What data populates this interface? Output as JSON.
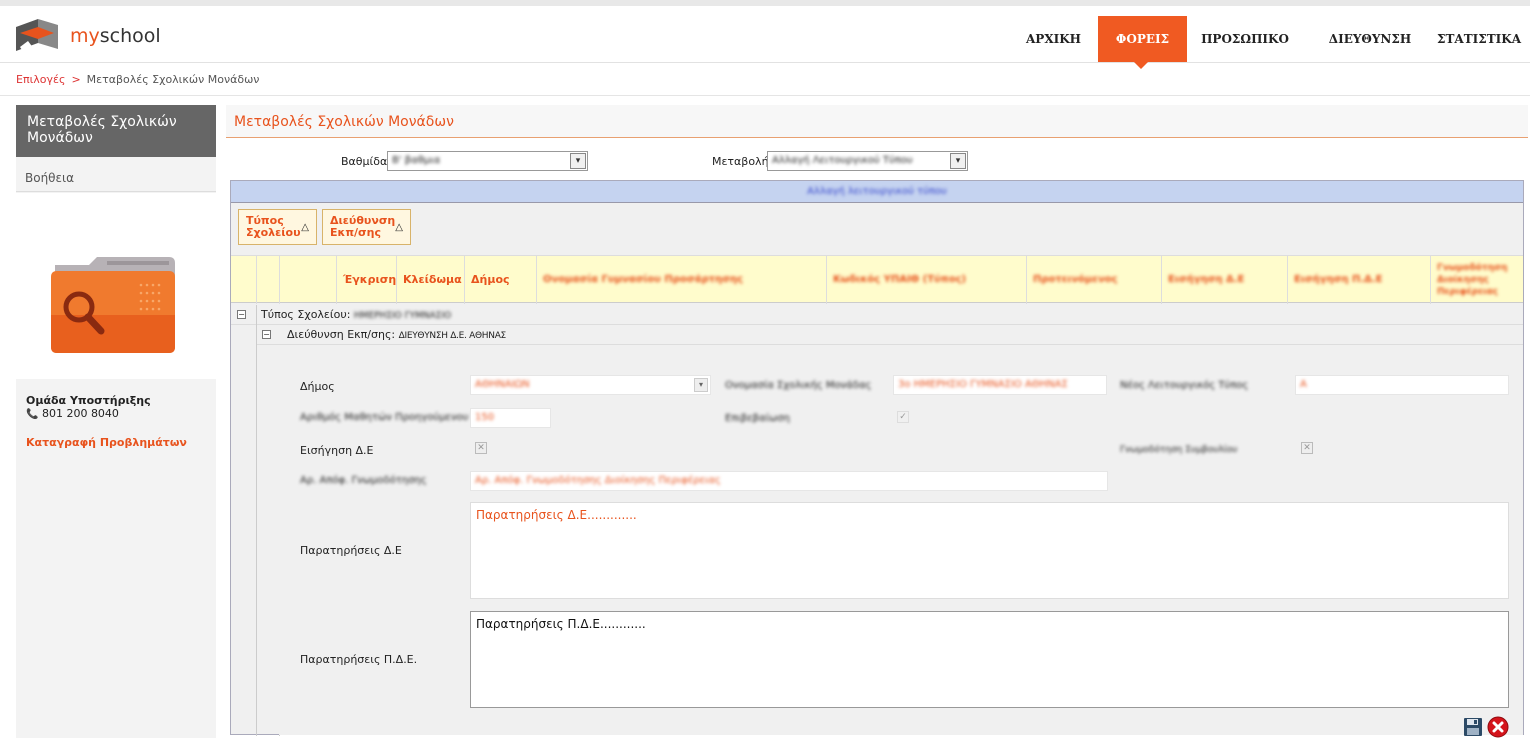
{
  "app": {
    "logo_prefix": "my",
    "logo_suffix": "school"
  },
  "nav": {
    "items": [
      {
        "label": "ΑΡΧΙΚΗ"
      },
      {
        "label": "ΦΟΡΕΙΣ"
      },
      {
        "label": "ΠΡΟΣΩΠΙΚΟ"
      },
      {
        "label": "ΔΙΕΥΘΥΝΣΗ"
      },
      {
        "label": "ΣΤΑΤΙΣΤΙΚΑ"
      }
    ],
    "active": "ΦΟΡΕΙΣ"
  },
  "breadcrumb": {
    "root": "Επιλογές",
    "separator": ">",
    "current": "Μεταβολές Σχολικών Μονάδων"
  },
  "sidebar": {
    "title": "Μεταβολές Σχολικών Μονάδων",
    "help": "Βοήθεια",
    "support_title": "Ομάδα Υποστήριξης",
    "phone": "801 200 8040",
    "report_link": "Καταγραφή Προβλημάτων"
  },
  "main": {
    "title": "Μεταβολές Σχολικών Μονάδων",
    "filters": {
      "grade_label": "Βαθμίδα",
      "grade_value": "Β' βαθμια",
      "change_label": "Μεταβολή",
      "change_value": "Αλλαγή Λειτουργικού Τύπου"
    }
  },
  "grid": {
    "header_title": "Αλλαγή λειτουργικού τύπου",
    "group_buttons": [
      {
        "line1": "Τύπος",
        "line2": "Σχολείου"
      },
      {
        "line1": "Διεύθυνση",
        "line2": "Εκπ/σης"
      }
    ],
    "columns": [
      "Έγκριση",
      "Κλείδωμα",
      "Δήμος",
      "Ονομασία Γυμνασίου Προσάρτησης",
      "Κωδικός ΥΠΑΙΘ (Τύπος)",
      "Προτεινόμενος",
      "Εισήγηση Δ.Ε",
      "Εισήγηση Π.Δ.Ε",
      "Γνωμοδότηση Διοίκησης Περιφέρειας"
    ],
    "group1": {
      "prefix": "Τύπος Σχολείου: ",
      "value": "ΗΜΕΡΗΣΙΟ ΓΥΜΝΑΣΙΟ"
    },
    "group2": {
      "prefix": "Διεύθυνση Εκπ/σης: ",
      "value": "ΔΙΕΥΘΥΝΣΗ Δ.Ε. ΑΘΗΝΑΣ"
    }
  },
  "form": {
    "dimos_label": "Δήμος",
    "dimos_value": "ΑΘΗΝΑΙΩΝ",
    "school_name_label": "Ονομασία Σχολικής Μονάδας",
    "school_name_value": "3ο ΗΜΕΡΗΣΙΟ ΓΥΜΝΑΣΙΟ ΑΘΗΝΑΣ",
    "new_type_label": "Νέος Λειτουργικός Τύπος",
    "new_type_value": "Α",
    "students_label": "Αριθμός Μαθητών Προηγούμενου Έτους",
    "students_value": "150",
    "approval_label": "Επιβεβαίωση",
    "eisigisi_de_label": "Εισήγηση Δ.Ε",
    "gnomodotisi_label": "Γνωμοδότηση Συμβουλίου",
    "decision_label": "Αρ. Απόφ. Γνωμοδότησης",
    "decision_value": "Αρ. Απόφ. Γνωμοδότησης Διοίκησης Περιφέρειας",
    "notes_de_label": "Παρατηρήσεις Δ.Ε",
    "notes_de_value": "Παρατηρήσεις Δ.Ε.............",
    "notes_pde_label": "Παρατηρήσεις Π.Δ.Ε.",
    "notes_pde_value": "Παρατηρήσεις Π.Δ.Ε............"
  },
  "colors": {
    "accent": "#f05a22",
    "link": "#e8531d",
    "grid_header": "#c5d3f0",
    "column_bg": "#fffccc"
  }
}
